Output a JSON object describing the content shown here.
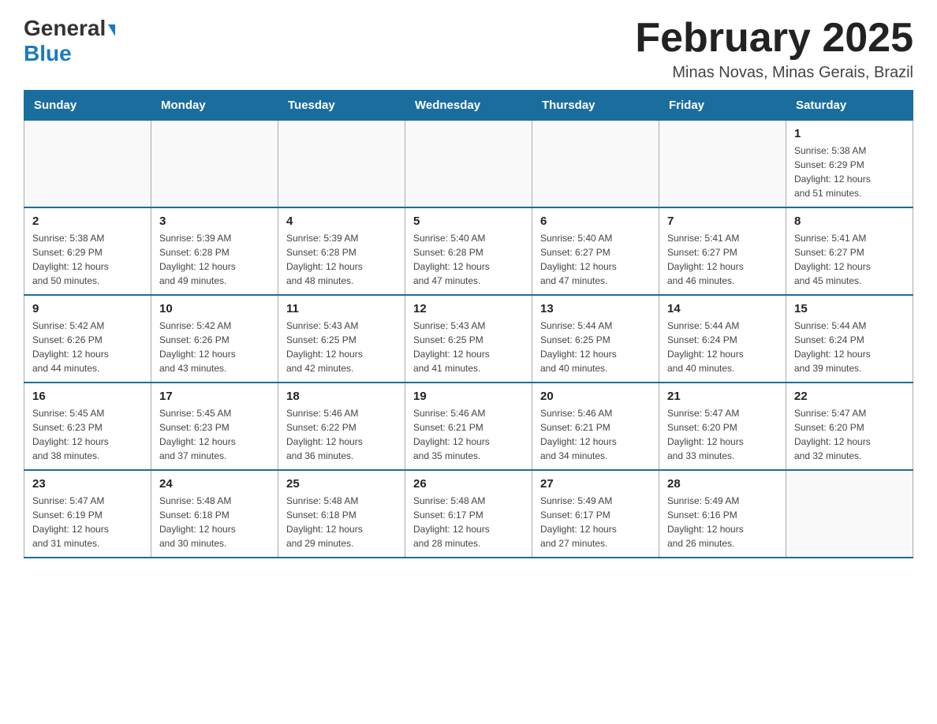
{
  "header": {
    "logo_general": "General",
    "logo_blue": "Blue",
    "month_title": "February 2025",
    "location": "Minas Novas, Minas Gerais, Brazil"
  },
  "days_of_week": [
    "Sunday",
    "Monday",
    "Tuesday",
    "Wednesday",
    "Thursday",
    "Friday",
    "Saturday"
  ],
  "weeks": [
    [
      {
        "day": "",
        "info": ""
      },
      {
        "day": "",
        "info": ""
      },
      {
        "day": "",
        "info": ""
      },
      {
        "day": "",
        "info": ""
      },
      {
        "day": "",
        "info": ""
      },
      {
        "day": "",
        "info": ""
      },
      {
        "day": "1",
        "info": "Sunrise: 5:38 AM\nSunset: 6:29 PM\nDaylight: 12 hours\nand 51 minutes."
      }
    ],
    [
      {
        "day": "2",
        "info": "Sunrise: 5:38 AM\nSunset: 6:29 PM\nDaylight: 12 hours\nand 50 minutes."
      },
      {
        "day": "3",
        "info": "Sunrise: 5:39 AM\nSunset: 6:28 PM\nDaylight: 12 hours\nand 49 minutes."
      },
      {
        "day": "4",
        "info": "Sunrise: 5:39 AM\nSunset: 6:28 PM\nDaylight: 12 hours\nand 48 minutes."
      },
      {
        "day": "5",
        "info": "Sunrise: 5:40 AM\nSunset: 6:28 PM\nDaylight: 12 hours\nand 47 minutes."
      },
      {
        "day": "6",
        "info": "Sunrise: 5:40 AM\nSunset: 6:27 PM\nDaylight: 12 hours\nand 47 minutes."
      },
      {
        "day": "7",
        "info": "Sunrise: 5:41 AM\nSunset: 6:27 PM\nDaylight: 12 hours\nand 46 minutes."
      },
      {
        "day": "8",
        "info": "Sunrise: 5:41 AM\nSunset: 6:27 PM\nDaylight: 12 hours\nand 45 minutes."
      }
    ],
    [
      {
        "day": "9",
        "info": "Sunrise: 5:42 AM\nSunset: 6:26 PM\nDaylight: 12 hours\nand 44 minutes."
      },
      {
        "day": "10",
        "info": "Sunrise: 5:42 AM\nSunset: 6:26 PM\nDaylight: 12 hours\nand 43 minutes."
      },
      {
        "day": "11",
        "info": "Sunrise: 5:43 AM\nSunset: 6:25 PM\nDaylight: 12 hours\nand 42 minutes."
      },
      {
        "day": "12",
        "info": "Sunrise: 5:43 AM\nSunset: 6:25 PM\nDaylight: 12 hours\nand 41 minutes."
      },
      {
        "day": "13",
        "info": "Sunrise: 5:44 AM\nSunset: 6:25 PM\nDaylight: 12 hours\nand 40 minutes."
      },
      {
        "day": "14",
        "info": "Sunrise: 5:44 AM\nSunset: 6:24 PM\nDaylight: 12 hours\nand 40 minutes."
      },
      {
        "day": "15",
        "info": "Sunrise: 5:44 AM\nSunset: 6:24 PM\nDaylight: 12 hours\nand 39 minutes."
      }
    ],
    [
      {
        "day": "16",
        "info": "Sunrise: 5:45 AM\nSunset: 6:23 PM\nDaylight: 12 hours\nand 38 minutes."
      },
      {
        "day": "17",
        "info": "Sunrise: 5:45 AM\nSunset: 6:23 PM\nDaylight: 12 hours\nand 37 minutes."
      },
      {
        "day": "18",
        "info": "Sunrise: 5:46 AM\nSunset: 6:22 PM\nDaylight: 12 hours\nand 36 minutes."
      },
      {
        "day": "19",
        "info": "Sunrise: 5:46 AM\nSunset: 6:21 PM\nDaylight: 12 hours\nand 35 minutes."
      },
      {
        "day": "20",
        "info": "Sunrise: 5:46 AM\nSunset: 6:21 PM\nDaylight: 12 hours\nand 34 minutes."
      },
      {
        "day": "21",
        "info": "Sunrise: 5:47 AM\nSunset: 6:20 PM\nDaylight: 12 hours\nand 33 minutes."
      },
      {
        "day": "22",
        "info": "Sunrise: 5:47 AM\nSunset: 6:20 PM\nDaylight: 12 hours\nand 32 minutes."
      }
    ],
    [
      {
        "day": "23",
        "info": "Sunrise: 5:47 AM\nSunset: 6:19 PM\nDaylight: 12 hours\nand 31 minutes."
      },
      {
        "day": "24",
        "info": "Sunrise: 5:48 AM\nSunset: 6:18 PM\nDaylight: 12 hours\nand 30 minutes."
      },
      {
        "day": "25",
        "info": "Sunrise: 5:48 AM\nSunset: 6:18 PM\nDaylight: 12 hours\nand 29 minutes."
      },
      {
        "day": "26",
        "info": "Sunrise: 5:48 AM\nSunset: 6:17 PM\nDaylight: 12 hours\nand 28 minutes."
      },
      {
        "day": "27",
        "info": "Sunrise: 5:49 AM\nSunset: 6:17 PM\nDaylight: 12 hours\nand 27 minutes."
      },
      {
        "day": "28",
        "info": "Sunrise: 5:49 AM\nSunset: 6:16 PM\nDaylight: 12 hours\nand 26 minutes."
      },
      {
        "day": "",
        "info": ""
      }
    ]
  ]
}
